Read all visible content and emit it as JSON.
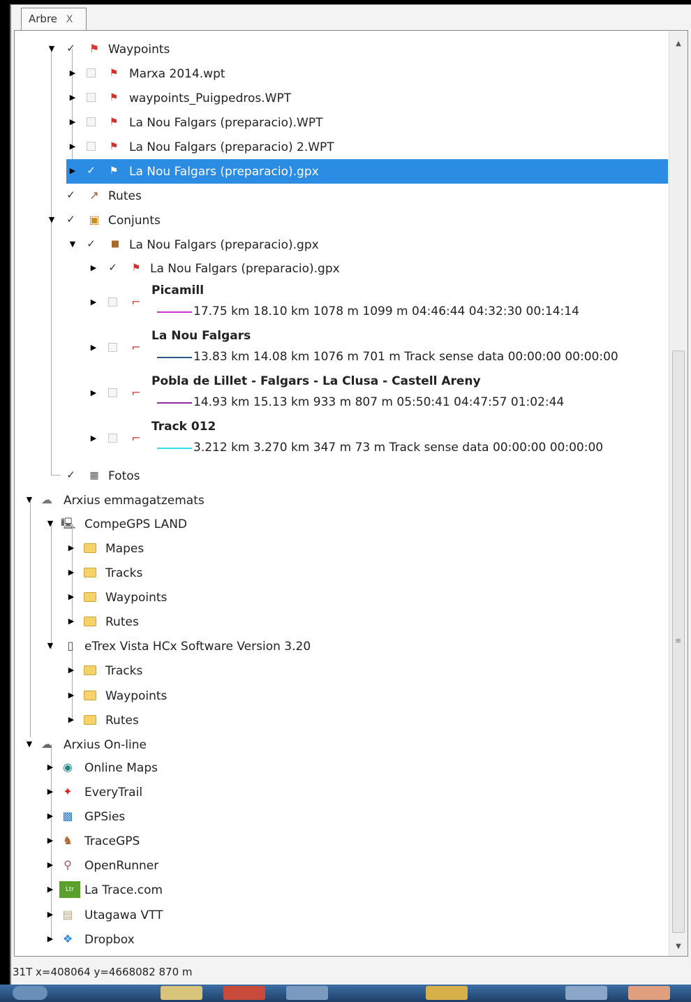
{
  "tab": {
    "label": "Arbre",
    "close": "X"
  },
  "tree": {
    "waypoints": {
      "label": "Waypoints",
      "items": [
        "Marxa 2014.wpt",
        "waypoints_Puigpedros.WPT",
        "La Nou Falgars (preparacio).WPT",
        "La Nou Falgars (preparacio) 2.WPT",
        "La Nou Falgars (preparacio).gpx"
      ]
    },
    "rutes": {
      "label": "Rutes"
    },
    "conjunts": {
      "label": "Conjunts",
      "set_label": "La Nou Falgars (preparacio).gpx",
      "set_wpt_label": "La Nou Falgars (preparacio).gpx",
      "tracks": [
        {
          "title": "Picamill",
          "stats": "17.75 km 18.10 km 1078 m 1099 m 04:46:44 04:32:30 00:14:14",
          "color": "#cc33cc"
        },
        {
          "title": "La Nou Falgars",
          "stats": "13.83 km 14.08 km 1076 m 701 m Track sense data 00:00:00 00:00:00",
          "color": "#2c5a82"
        },
        {
          "title": "Pobla de Lillet - Falgars - La Clusa - Castell Areny",
          "stats": "14.93 km 15.13 km 933 m 807 m 05:50:41 04:47:57 01:02:44",
          "color": "#8e2a9e"
        },
        {
          "title": "Track 012",
          "stats": "3.212 km 3.270 km 347 m 73 m Track sense data 00:00:00 00:00:00",
          "color": "#33ddee"
        }
      ]
    },
    "fotos": {
      "label": "Fotos"
    },
    "stored": {
      "label": "Arxius emmagatzemats",
      "compegps": {
        "label": "CompeGPS LAND",
        "folders": [
          "Mapes",
          "Tracks",
          "Waypoints",
          "Rutes"
        ]
      },
      "etrex": {
        "label": "eTrex Vista HCx Software Version 3.20",
        "folders": [
          "Tracks",
          "Waypoints",
          "Rutes"
        ]
      }
    },
    "online": {
      "label": "Arxius On-line",
      "services": [
        {
          "label": "Online Maps",
          "icon": "online-maps-icon"
        },
        {
          "label": "EveryTrail",
          "icon": "everytrail-icon"
        },
        {
          "label": "GPSies",
          "icon": "gpsies-icon"
        },
        {
          "label": "TraceGPS",
          "icon": "tracegps-icon"
        },
        {
          "label": "OpenRunner",
          "icon": "openrunner-icon"
        },
        {
          "label": "La Trace.com",
          "icon": "latrace-icon"
        },
        {
          "label": "Utagawa VTT",
          "icon": "utagawa-icon"
        },
        {
          "label": "Dropbox",
          "icon": "dropbox-icon"
        }
      ]
    }
  },
  "status": {
    "text": "31T  x=408064  y=4668082  870 m"
  },
  "colors": {
    "selection": "#2b8ce4",
    "folder": "#f5d36a"
  }
}
